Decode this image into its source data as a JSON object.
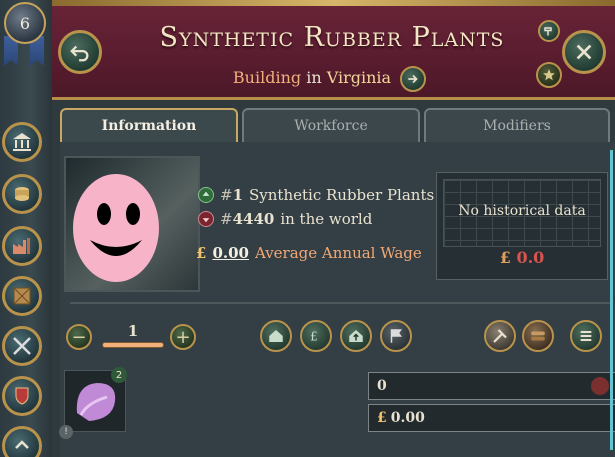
{
  "rank_level": "6",
  "header": {
    "title": "Synthetic Rubber Plants",
    "subtitle_type": "Building",
    "subtitle_in": "in",
    "subtitle_place": "Virginia"
  },
  "tabs": [
    "Information",
    "Workforce",
    "Modifiers"
  ],
  "info": {
    "rank1_prefix": "#",
    "rank1_value": "1",
    "rank1_label": "Synthetic Rubber Plants",
    "rank2_prefix": "#",
    "rank2_value": "4440",
    "rank2_label": "in the world",
    "wage_symbol": "£",
    "wage_value": "0.00",
    "wage_label": "Average Annual Wage"
  },
  "history": {
    "no_data_text": "No historical data",
    "currency": "£",
    "value": "0.0"
  },
  "stepper": {
    "value": "1",
    "minus": "−",
    "plus": "+"
  },
  "goods": {
    "badge": "2",
    "info_icon": "!"
  },
  "fields": {
    "employment_value": "0",
    "money_symbol": "£",
    "money_value": "0.00"
  },
  "icons": {
    "rank": "shield-icon",
    "back": "back-arrow-icon",
    "close": "close-icon",
    "nav": "arrow-right-icon"
  }
}
